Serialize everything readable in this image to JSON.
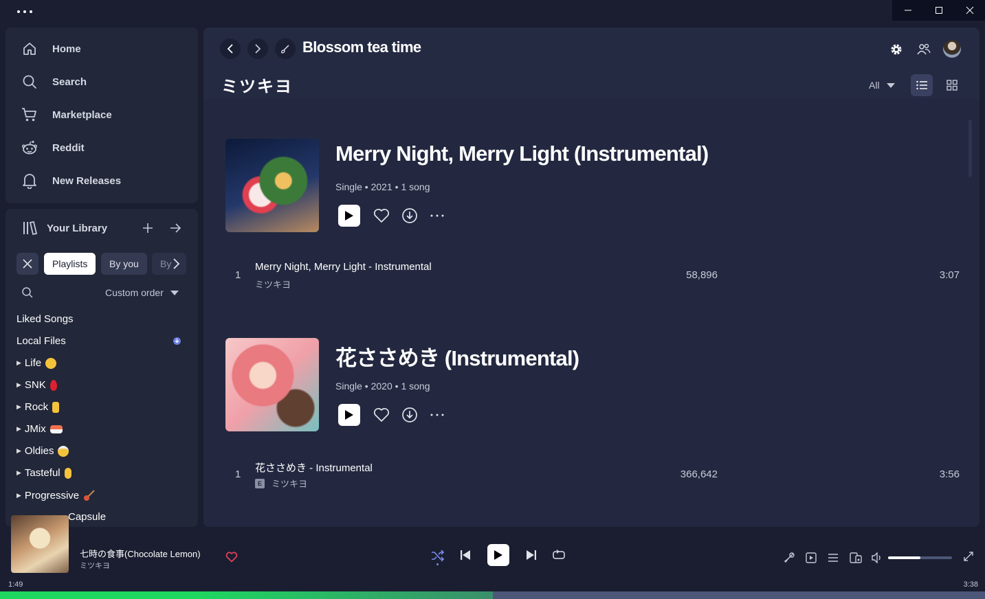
{
  "nav": {
    "items": [
      {
        "label": "Home",
        "icon": "home-icon"
      },
      {
        "label": "Search",
        "icon": "search-icon"
      },
      {
        "label": "Marketplace",
        "icon": "cart-icon"
      },
      {
        "label": "Reddit",
        "icon": "reddit-icon"
      },
      {
        "label": "New Releases",
        "icon": "bell-icon"
      }
    ]
  },
  "library": {
    "title": "Your Library",
    "chips": [
      "Playlists",
      "By you",
      "By"
    ],
    "sort_label": "Custom order",
    "items": [
      {
        "label": "Liked Songs",
        "folder": false
      },
      {
        "label": "Local Files",
        "folder": false
      },
      {
        "label": "Life",
        "folder": true,
        "emoji": "😟"
      },
      {
        "label": "SNK",
        "folder": true,
        "emoji": "🩸"
      },
      {
        "label": "Rock",
        "folder": true,
        "emoji": "🤘"
      },
      {
        "label": "JMix",
        "folder": true,
        "emoji": "🍣"
      },
      {
        "label": "Oldies",
        "folder": true,
        "emoji": "👴"
      },
      {
        "label": "Tasteful",
        "folder": true,
        "emoji": "👌"
      },
      {
        "label": "Progressive",
        "folder": true,
        "emoji": "🎸"
      },
      {
        "label": "Capsule",
        "folder": true
      }
    ]
  },
  "main": {
    "page_title": "Blossom tea time",
    "artist_header": "ミツキヨ",
    "filter_label": "All",
    "albums": [
      {
        "title": "Merry Night, Merry Light (Instrumental)",
        "type": "Single",
        "year": "2021",
        "count": "1 song",
        "tracks": [
          {
            "num": "1",
            "name": "Merry Night, Merry Light - Instrumental",
            "artist": "ミツキヨ",
            "plays": "58,896",
            "duration": "3:07",
            "explicit": false
          }
        ]
      },
      {
        "title": "花ささめき (Instrumental)",
        "type": "Single",
        "year": "2020",
        "count": "1 song",
        "tracks": [
          {
            "num": "1",
            "name": "花ささめき - Instrumental",
            "artist": "ミツキヨ",
            "plays": "366,642",
            "duration": "3:56",
            "explicit": true
          }
        ]
      }
    ]
  },
  "player": {
    "track_title": "七時の食事(Chocolate Lemon)",
    "track_artist": "ミツキヨ",
    "elapsed": "1:49",
    "total": "3:38",
    "progress": 0.5,
    "volume": 0.5,
    "explicit_badge": "E"
  },
  "colors": {
    "background": "#1a1e30",
    "panel": "#222739",
    "main_panel": "#232840",
    "progress_accent": "#1ed760",
    "heart_accent": "#e3435a",
    "shuffle_active": "#7d8cf0",
    "info_badge": "#6b7fe0"
  }
}
